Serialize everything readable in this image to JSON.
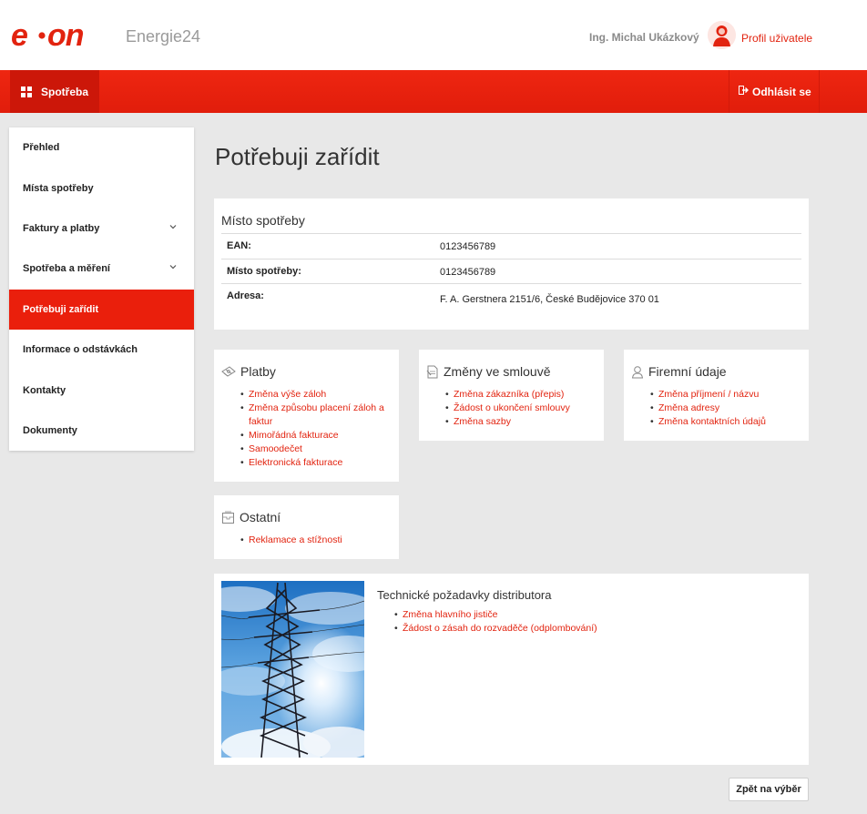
{
  "header": {
    "logo_text": "e·on",
    "app_name": "Energie24",
    "user_name": "Ing. Michal Ukázkový",
    "profile_label": "Profil uživatele"
  },
  "navbar": {
    "spotreba_label": "Spotřeba",
    "logout_label": "Odhlásit se"
  },
  "sidebar": {
    "items": [
      {
        "label": "Přehled"
      },
      {
        "label": "Místa spotřeby"
      },
      {
        "label": "Faktury a platby"
      },
      {
        "label": "Spotřeba a měření"
      },
      {
        "label": "Potřebuji zařídit"
      },
      {
        "label": "Informace o odstávkách"
      },
      {
        "label": "Kontakty"
      },
      {
        "label": "Dokumenty"
      }
    ]
  },
  "main": {
    "title": "Potřebuji zařídit",
    "place": {
      "title": "Místo spotřeby",
      "rows": [
        {
          "key": "EAN:",
          "value": "0123456789"
        },
        {
          "key": "Místo spotřeby:",
          "value": "0123456789"
        },
        {
          "key": "Adresa:",
          "value": "F. A. Gerstnera 2151/6, České Budějovice 370 01"
        }
      ]
    },
    "cards": {
      "platby": {
        "title": "Platby",
        "links": [
          "Změna výše záloh",
          "Změna způsobu placení záloh a faktur",
          "Mimořádná fakturace",
          "Samoodečet",
          "Elektronická fakturace"
        ]
      },
      "smlouva": {
        "title": "Změny ve smlouvě",
        "links": [
          "Změna zákazníka (přepis)",
          "Žádost o ukončení smlouvy",
          "Změna sazby"
        ]
      },
      "firemni": {
        "title": "Firemní údaje",
        "links": [
          "Změna příjmení / názvu",
          "Změna adresy",
          "Změna kontaktních údajů"
        ]
      },
      "ostatni": {
        "title": "Ostatní",
        "links": [
          "Reklamace a stížnosti"
        ]
      }
    },
    "tech": {
      "title": "Technické požadavky distributora",
      "links": [
        "Změna hlavního jističe",
        "Žádost o zásah do rozvaděče (odplombování)"
      ]
    },
    "back_label": "Zpět na výběr"
  },
  "colors": {
    "brand_red": "#ea1f0c",
    "nav_dark_red": "#cc1709",
    "link_red": "#e2230f"
  }
}
